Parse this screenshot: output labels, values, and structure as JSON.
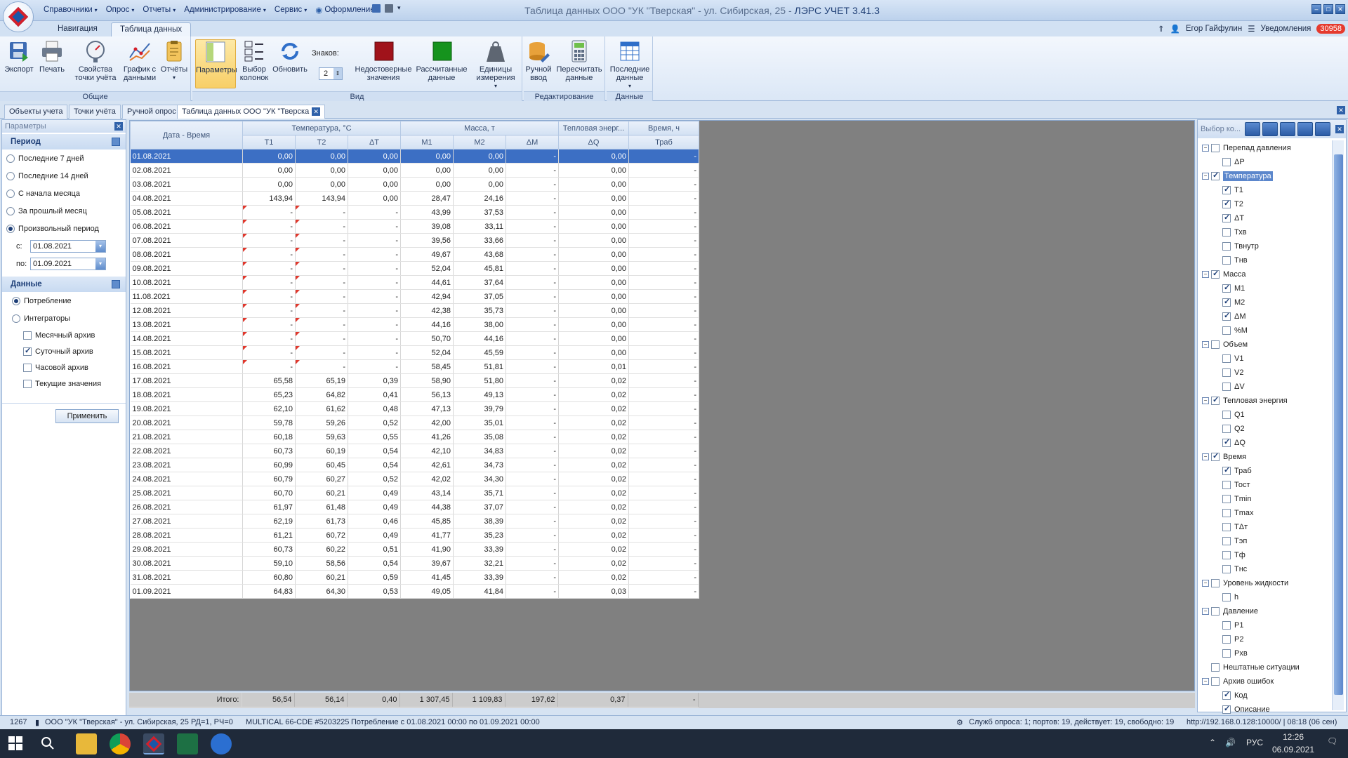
{
  "app": {
    "title_prefix": "Таблица данных ООО \"УК \"Тверская\" - ул. Сибирская, 25 -",
    "title_suffix": "ЛЭРС УЧЕТ 3.41.3"
  },
  "menu": [
    "Справочники",
    "Опрос",
    "Отчеты",
    "Администрирование",
    "Сервис",
    "Оформление"
  ],
  "ribbon_tabs": [
    "Навигация",
    "Таблица данных"
  ],
  "user": {
    "name": "Егор Гайфулин",
    "notifications_label": "Уведомления",
    "notifications_count": "30958"
  },
  "ribbon": {
    "general": {
      "label": "Общие",
      "buttons": [
        "Экспорт",
        "Печать",
        "Свойства точки учёта",
        "График с данными",
        "Отчёты"
      ]
    },
    "view": {
      "label": "Вид",
      "buttons": [
        "Параметры",
        "Выбор колонок",
        "Обновить"
      ],
      "digits_label": "Знаков:",
      "digits_value": "2",
      "buttons2": [
        "Недостоверные значения",
        "Рассчитанные данные",
        "Единицы измерения"
      ]
    },
    "edit": {
      "label": "Редактирование",
      "buttons": [
        "Ручной ввод",
        "Пересчитать данные"
      ]
    },
    "data": {
      "label": "Данные",
      "buttons": [
        "Последние данные"
      ]
    }
  },
  "doc_tabs": [
    "Объекты учета",
    "Точки учёта",
    "Ручной опрос",
    "Таблица данных ООО \"УК \"Тверска"
  ],
  "left_panel": {
    "header": "Параметры",
    "period": {
      "title": "Период",
      "options": [
        "Последние 7 дней",
        "Последние 14 дней",
        "С начала месяца",
        "За прошлый месяц",
        "Произвольный период"
      ],
      "selected": 4,
      "from_label": "с:",
      "from_value": "01.08.2021",
      "to_label": "по:",
      "to_value": "01.09.2021"
    },
    "data": {
      "title": "Данные",
      "modes": [
        "Потребление",
        "Интеграторы"
      ],
      "selected_mode": 0,
      "archives": [
        {
          "label": "Месячный архив",
          "checked": false
        },
        {
          "label": "Суточный архив",
          "checked": true
        },
        {
          "label": "Часовой архив",
          "checked": false
        },
        {
          "label": "Текущие значения",
          "checked": false
        }
      ]
    },
    "apply": "Применить"
  },
  "grid": {
    "col_date": "Дата - Время",
    "groups": [
      "Температура, °С",
      "Масса, т",
      "Тепловая энерг...",
      "Время, ч"
    ],
    "cols": [
      "T1",
      "T2",
      "ΔT",
      "M1",
      "M2",
      "ΔM",
      "ΔQ",
      "Траб"
    ],
    "rows": [
      [
        "01.08.2021",
        "0,00",
        "0,00",
        "0,00",
        "0,00",
        "0,00",
        "-",
        "0,00",
        "-"
      ],
      [
        "02.08.2021",
        "0,00",
        "0,00",
        "0,00",
        "0,00",
        "0,00",
        "-",
        "0,00",
        "-"
      ],
      [
        "03.08.2021",
        "0,00",
        "0,00",
        "0,00",
        "0,00",
        "0,00",
        "-",
        "0,00",
        "-"
      ],
      [
        "04.08.2021",
        "143,94",
        "143,94",
        "0,00",
        "28,47",
        "24,16",
        "-",
        "0,00",
        "-"
      ],
      [
        "05.08.2021",
        "-",
        "-",
        "-",
        "43,99",
        "37,53",
        "-",
        "0,00",
        "-"
      ],
      [
        "06.08.2021",
        "-",
        "-",
        "-",
        "39,08",
        "33,11",
        "-",
        "0,00",
        "-"
      ],
      [
        "07.08.2021",
        "-",
        "-",
        "-",
        "39,56",
        "33,66",
        "-",
        "0,00",
        "-"
      ],
      [
        "08.08.2021",
        "-",
        "-",
        "-",
        "49,67",
        "43,68",
        "-",
        "0,00",
        "-"
      ],
      [
        "09.08.2021",
        "-",
        "-",
        "-",
        "52,04",
        "45,81",
        "-",
        "0,00",
        "-"
      ],
      [
        "10.08.2021",
        "-",
        "-",
        "-",
        "44,61",
        "37,64",
        "-",
        "0,00",
        "-"
      ],
      [
        "11.08.2021",
        "-",
        "-",
        "-",
        "42,94",
        "37,05",
        "-",
        "0,00",
        "-"
      ],
      [
        "12.08.2021",
        "-",
        "-",
        "-",
        "42,38",
        "35,73",
        "-",
        "0,00",
        "-"
      ],
      [
        "13.08.2021",
        "-",
        "-",
        "-",
        "44,16",
        "38,00",
        "-",
        "0,00",
        "-"
      ],
      [
        "14.08.2021",
        "-",
        "-",
        "-",
        "50,70",
        "44,16",
        "-",
        "0,00",
        "-"
      ],
      [
        "15.08.2021",
        "-",
        "-",
        "-",
        "52,04",
        "45,59",
        "-",
        "0,00",
        "-"
      ],
      [
        "16.08.2021",
        "-",
        "-",
        "-",
        "58,45",
        "51,81",
        "-",
        "0,01",
        "-"
      ],
      [
        "17.08.2021",
        "65,58",
        "65,19",
        "0,39",
        "58,90",
        "51,80",
        "-",
        "0,02",
        "-"
      ],
      [
        "18.08.2021",
        "65,23",
        "64,82",
        "0,41",
        "56,13",
        "49,13",
        "-",
        "0,02",
        "-"
      ],
      [
        "19.08.2021",
        "62,10",
        "61,62",
        "0,48",
        "47,13",
        "39,79",
        "-",
        "0,02",
        "-"
      ],
      [
        "20.08.2021",
        "59,78",
        "59,26",
        "0,52",
        "42,00",
        "35,01",
        "-",
        "0,02",
        "-"
      ],
      [
        "21.08.2021",
        "60,18",
        "59,63",
        "0,55",
        "41,26",
        "35,08",
        "-",
        "0,02",
        "-"
      ],
      [
        "22.08.2021",
        "60,73",
        "60,19",
        "0,54",
        "42,10",
        "34,83",
        "-",
        "0,02",
        "-"
      ],
      [
        "23.08.2021",
        "60,99",
        "60,45",
        "0,54",
        "42,61",
        "34,73",
        "-",
        "0,02",
        "-"
      ],
      [
        "24.08.2021",
        "60,79",
        "60,27",
        "0,52",
        "42,02",
        "34,30",
        "-",
        "0,02",
        "-"
      ],
      [
        "25.08.2021",
        "60,70",
        "60,21",
        "0,49",
        "43,14",
        "35,71",
        "-",
        "0,02",
        "-"
      ],
      [
        "26.08.2021",
        "61,97",
        "61,48",
        "0,49",
        "44,38",
        "37,07",
        "-",
        "0,02",
        "-"
      ],
      [
        "27.08.2021",
        "62,19",
        "61,73",
        "0,46",
        "45,85",
        "38,39",
        "-",
        "0,02",
        "-"
      ],
      [
        "28.08.2021",
        "61,21",
        "60,72",
        "0,49",
        "41,77",
        "35,23",
        "-",
        "0,02",
        "-"
      ],
      [
        "29.08.2021",
        "60,73",
        "60,22",
        "0,51",
        "41,90",
        "33,39",
        "-",
        "0,02",
        "-"
      ],
      [
        "30.08.2021",
        "59,10",
        "58,56",
        "0,54",
        "39,67",
        "32,21",
        "-",
        "0,02",
        "-"
      ],
      [
        "31.08.2021",
        "60,80",
        "60,21",
        "0,59",
        "41,45",
        "33,39",
        "-",
        "0,02",
        "-"
      ],
      [
        "01.09.2021",
        "64,83",
        "64,30",
        "0,53",
        "49,05",
        "41,84",
        "-",
        "0,03",
        "-"
      ]
    ],
    "footer_label": "Итого:",
    "footer": [
      "56,54",
      "56,14",
      "0,40",
      "1 307,45",
      "1 109,83",
      "197,62",
      "0,37",
      "-"
    ]
  },
  "right_panel": {
    "header": "Выбор ко...",
    "tree": [
      {
        "label": "Перепад давления",
        "level": 0,
        "checked": false
      },
      {
        "label": "ΔP",
        "level": 1,
        "checked": false
      },
      {
        "label": "Температура",
        "level": 0,
        "checked": true,
        "selected": true
      },
      {
        "label": "T1",
        "level": 1,
        "checked": true
      },
      {
        "label": "T2",
        "level": 1,
        "checked": true
      },
      {
        "label": "ΔT",
        "level": 1,
        "checked": true
      },
      {
        "label": "Тхв",
        "level": 1,
        "checked": false
      },
      {
        "label": "Твнутр",
        "level": 1,
        "checked": false
      },
      {
        "label": "Тнв",
        "level": 1,
        "checked": false
      },
      {
        "label": "Масса",
        "level": 0,
        "checked": true
      },
      {
        "label": "M1",
        "level": 1,
        "checked": true
      },
      {
        "label": "M2",
        "level": 1,
        "checked": true
      },
      {
        "label": "ΔM",
        "level": 1,
        "checked": true
      },
      {
        "label": "%M",
        "level": 1,
        "checked": false
      },
      {
        "label": "Объем",
        "level": 0,
        "checked": false
      },
      {
        "label": "V1",
        "level": 1,
        "checked": false
      },
      {
        "label": "V2",
        "level": 1,
        "checked": false
      },
      {
        "label": "ΔV",
        "level": 1,
        "checked": false
      },
      {
        "label": "Тепловая энергия",
        "level": 0,
        "checked": true
      },
      {
        "label": "Q1",
        "level": 1,
        "checked": false
      },
      {
        "label": "Q2",
        "level": 1,
        "checked": false
      },
      {
        "label": "ΔQ",
        "level": 1,
        "checked": true
      },
      {
        "label": "Время",
        "level": 0,
        "checked": true
      },
      {
        "label": "Траб",
        "level": 1,
        "checked": true
      },
      {
        "label": "Тост",
        "level": 1,
        "checked": false
      },
      {
        "label": "Tmin",
        "level": 1,
        "checked": false
      },
      {
        "label": "Tmax",
        "level": 1,
        "checked": false
      },
      {
        "label": "TΔт",
        "level": 1,
        "checked": false
      },
      {
        "label": "Тэп",
        "level": 1,
        "checked": false
      },
      {
        "label": "Тф",
        "level": 1,
        "checked": false
      },
      {
        "label": "Тнс",
        "level": 1,
        "checked": false
      },
      {
        "label": "Уровень жидкости",
        "level": 0,
        "checked": false
      },
      {
        "label": "h",
        "level": 1,
        "checked": false
      },
      {
        "label": "Давление",
        "level": 0,
        "checked": false
      },
      {
        "label": "P1",
        "level": 1,
        "checked": false
      },
      {
        "label": "P2",
        "level": 1,
        "checked": false
      },
      {
        "label": "Рхв",
        "level": 1,
        "checked": false
      },
      {
        "label": "Нештатные ситуации",
        "level": 0,
        "checked": false,
        "leaf": true
      },
      {
        "label": "Архив ошибок",
        "level": 0,
        "checked": false
      },
      {
        "label": "Код",
        "level": 1,
        "checked": true
      },
      {
        "label": "Описание",
        "level": 1,
        "checked": true
      }
    ]
  },
  "status": {
    "id": "1267",
    "object": "ООО \"УК \"Тверская\" - ул. Сибирская, 25  РД=1, РЧ=0",
    "device": "MULTICAL 66-CDE #5203225",
    "consumption": "Потребление с 01.08.2021 00:00 по 01.09.2021 00:00",
    "services": "Служб опроса: 1; портов: 19, действует: 19, свободно: 19",
    "server": "http://192.168.0.128:10000/ | 08:18 (06 сен)"
  },
  "taskbar": {
    "lang": "РУС",
    "time": "12:26",
    "date": "06.09.2021"
  },
  "colors": {
    "accent": "#3c6fc4",
    "ribbon_bg": "#dbe7f6",
    "grid_empty": "#808080",
    "flag": "#e0382d",
    "badge": "#e53a2e"
  }
}
